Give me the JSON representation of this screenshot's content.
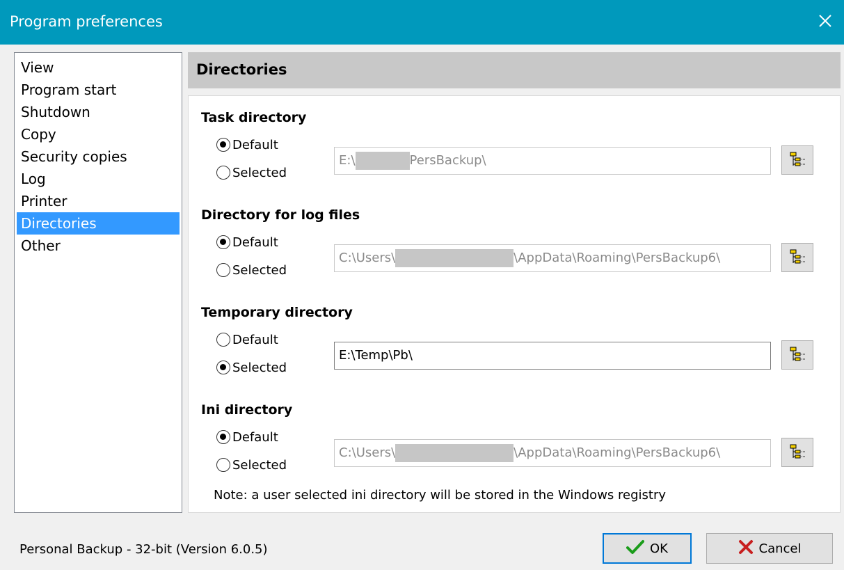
{
  "window": {
    "title": "Program preferences"
  },
  "nav": {
    "items": [
      "View",
      "Program start",
      "Shutdown",
      "Copy",
      "Security copies",
      "Log",
      "Printer",
      "Directories",
      "Other"
    ],
    "selected": "Directories"
  },
  "header": {
    "title": "Directories"
  },
  "sections": {
    "task": {
      "title": "Task directory",
      "default_label": "Default",
      "selected_label": "Selected",
      "value_prefix": "E:\\",
      "value_suffix": "PersBackup\\",
      "checked": "Default"
    },
    "log": {
      "title": "Directory for log files",
      "default_label": "Default",
      "selected_label": "Selected",
      "value_prefix": "C:\\Users\\",
      "value_suffix": "\\AppData\\Roaming\\PersBackup6\\",
      "checked": "Default"
    },
    "temp": {
      "title": "Temporary directory",
      "default_label": "Default",
      "selected_label": "Selected",
      "value": "E:\\Temp\\Pb\\",
      "checked": "Selected"
    },
    "ini": {
      "title": "Ini directory",
      "default_label": "Default",
      "selected_label": "Selected",
      "value_prefix": "C:\\Users\\",
      "value_suffix": "\\AppData\\Roaming\\PersBackup6\\",
      "checked": "Default"
    }
  },
  "note": "Note: a user selected ini directory will be stored in the Windows registry",
  "status": "Personal Backup - 32-bit (Version 6.0.5)",
  "buttons": {
    "ok": "OK",
    "cancel": "Cancel"
  },
  "colors": {
    "titlebar": "#0099bc",
    "selection": "#3399ff",
    "header": "#c8c8c8",
    "ok_check": "#1a9c1a",
    "cancel_x": "#c81e1e"
  },
  "icons": {
    "close": "close-icon",
    "browse": "folder-tree-icon",
    "ok": "checkmark-icon",
    "cancel": "x-icon"
  }
}
